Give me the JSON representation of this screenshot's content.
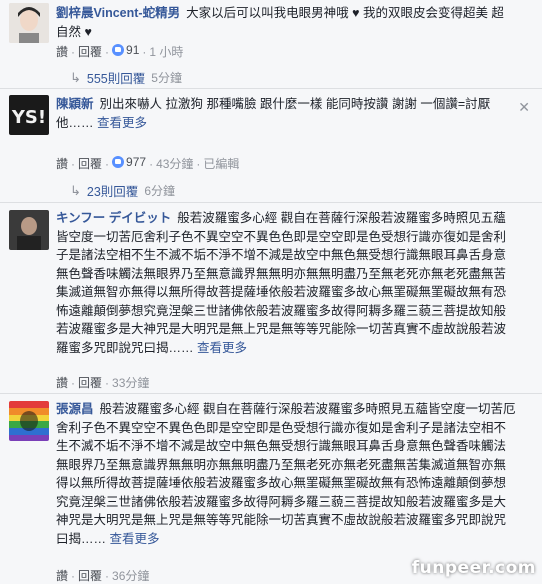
{
  "comments": [
    {
      "author": "劉梓晨Vincent-蛇精男",
      "text": "大家以后可以叫我电眼男神哦 ♥ 我的双眼皮会变得超美 超自然 ♥",
      "like_label": "讚",
      "reply_label": "回覆",
      "like_count": "91",
      "time": "1 小時",
      "replies_label": "555則回覆",
      "replies_age": "5分鐘"
    },
    {
      "author": "陳穎新",
      "text": "別出來嚇人 拉激狗 那種嘴臉 跟什麼一樣 能同時按讚 謝謝 一個讚=討厭他……",
      "more_label": "查看更多",
      "like_label": "讚",
      "reply_label": "回覆",
      "like_count": "977",
      "time": "43分鐘",
      "edited": "已編輯",
      "replies_label": "23則回覆",
      "replies_age": "6分鐘"
    },
    {
      "author": "キンフー デイビット",
      "text": "般若波羅蜜多心經 觀自在菩薩行深般若波羅蜜多時照见五蘊皆空度一切苦厄舍利子色不異空空不異色色即是空空即是色受想行識亦復如是舍利子是諸法空相不生不滅不垢不淨不增不減是故空中無色無受想行識無眼耳鼻舌身意無色聲香味觸法無眼界乃至無意識界無無明亦無無明盡乃至無老死亦無老死盡無苦集滅道無智亦無得以無所得故菩提薩埵依般若波羅蜜多故心無罣礙無罣礙故無有恐怖遠離顛倒夢想究竟涅槃三世諸佛依般若波羅蜜多故得阿耨多羅三藐三菩提故知般若波羅蜜多是大神咒是大明咒是無上咒是無等等咒能除一切苦真實不虛故說般若波羅蜜多咒即說咒曰揭……",
      "more_label": "查看更多",
      "like_label": "讚",
      "reply_label": "回覆",
      "time": "33分鐘"
    },
    {
      "author": "張源昌",
      "text": "般若波羅蜜多心經 觀自在菩薩行深般若波羅蜜多時照見五蘊皆空度一切苦厄舍利子色不異空空不異色色即是空空即是色受想行識亦復如是舍利子是諸法空相不生不滅不垢不淨不增不減是故空中無色無受想行識無眼耳鼻舌身意無色聲香味觸法無眼界乃至無意識界無無明亦無無明盡乃至無老死亦無老死盡無苦集滅道無智亦無得以無所得故菩提薩埵依般若波羅蜜多故心無罣礙無罣礙故無有恐怖遠離顛倒夢想究竟涅槃三世諸佛依般若波羅蜜多故得阿耨多羅三藐三菩提故知般若波羅蜜多是大神咒是大明咒是無上咒是無等等咒能除一切苦真實不虛故說般若波羅蜜多咒即說咒曰揭……",
      "more_label": "查看更多",
      "like_label": "讚",
      "reply_label": "回覆",
      "time": "36分鐘"
    }
  ],
  "watermark": "funpeer.com",
  "colors": {
    "link": "#365899",
    "meta": "#90949c",
    "like": "#5890ff",
    "bg": "#f6f7f9"
  }
}
